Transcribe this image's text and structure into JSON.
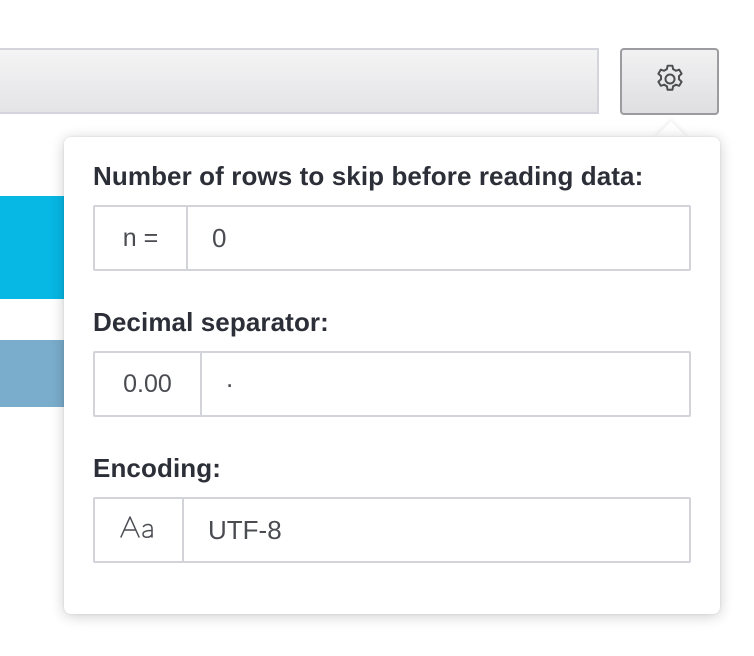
{
  "settings": {
    "button_icon": "gear-icon"
  },
  "popover": {
    "skip_rows": {
      "label": "Number of rows to skip before reading data:",
      "prefix": "n =",
      "value": "0"
    },
    "decimal_separator": {
      "label": "Decimal separator:",
      "prefix": "0.00",
      "value": "."
    },
    "encoding": {
      "label": "Encoding:",
      "prefix_icon": "text-case-icon",
      "value": "UTF-8"
    }
  },
  "colors": {
    "accent_cyan": "#07b7e4",
    "accent_steel": "#7aadcc",
    "label_text": "#2c2f37",
    "border": "#d3d4d9"
  }
}
